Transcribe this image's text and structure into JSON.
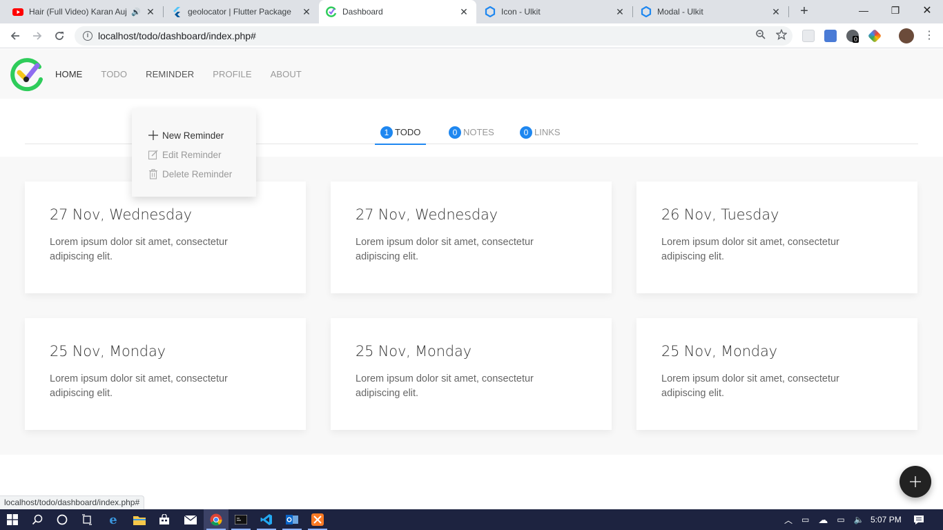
{
  "browser": {
    "tabs": [
      {
        "title": "Hair (Full Video) Karan Auj",
        "icon": "youtube-icon",
        "audio": true
      },
      {
        "title": "geolocator | Flutter Package",
        "icon": "flutter-icon"
      },
      {
        "title": "Dashboard",
        "icon": "todo-logo-icon",
        "active": true
      },
      {
        "title": "Icon - Ulkit",
        "icon": "uikit-icon"
      },
      {
        "title": "Modal - Ulkit",
        "icon": "uikit-icon"
      }
    ],
    "url": "localhost/todo/dashboard/index.php#",
    "status_url": "localhost/todo/dashboard/index.php#",
    "extension_badge": "0"
  },
  "nav": {
    "items": [
      "HOME",
      "TODO",
      "REMINDER",
      "PROFILE",
      "ABOUT"
    ],
    "active": "HOME"
  },
  "dropdown": {
    "items": [
      {
        "label": "New Reminder",
        "icon": "plus-icon"
      },
      {
        "label": "Edit Reminder",
        "icon": "edit-icon"
      },
      {
        "label": "Delete Reminder",
        "icon": "trash-icon"
      }
    ]
  },
  "subtabs": [
    {
      "count": "1",
      "label": "TODO",
      "active": true
    },
    {
      "count": "0",
      "label": "NOTES"
    },
    {
      "count": "0",
      "label": "LINKS"
    }
  ],
  "cards": [
    {
      "date": "27 Nov, Wednesday",
      "text": "Lorem ipsum dolor sit amet, consectetur adipiscing elit."
    },
    {
      "date": "27 Nov, Wednesday",
      "text": "Lorem ipsum dolor sit amet, consectetur adipiscing elit."
    },
    {
      "date": "26 Nov, Tuesday",
      "text": "Lorem ipsum dolor sit amet, consectetur adipiscing elit."
    },
    {
      "date": "25 Nov, Monday",
      "text": "Lorem ipsum dolor sit amet, consectetur adipiscing elit."
    },
    {
      "date": "25 Nov, Monday",
      "text": "Lorem ipsum dolor sit amet, consectetur adipiscing elit."
    },
    {
      "date": "25 Nov, Monday",
      "text": "Lorem ipsum dolor sit amet, consectetur adipiscing elit."
    }
  ],
  "taskbar": {
    "time": "5:07 PM"
  },
  "colors": {
    "accent": "#1e87f0",
    "fab": "#222222",
    "logo_green": "#2ecc5a",
    "logo_yellow": "#f5c518",
    "logo_purple": "#8e6cf0"
  }
}
